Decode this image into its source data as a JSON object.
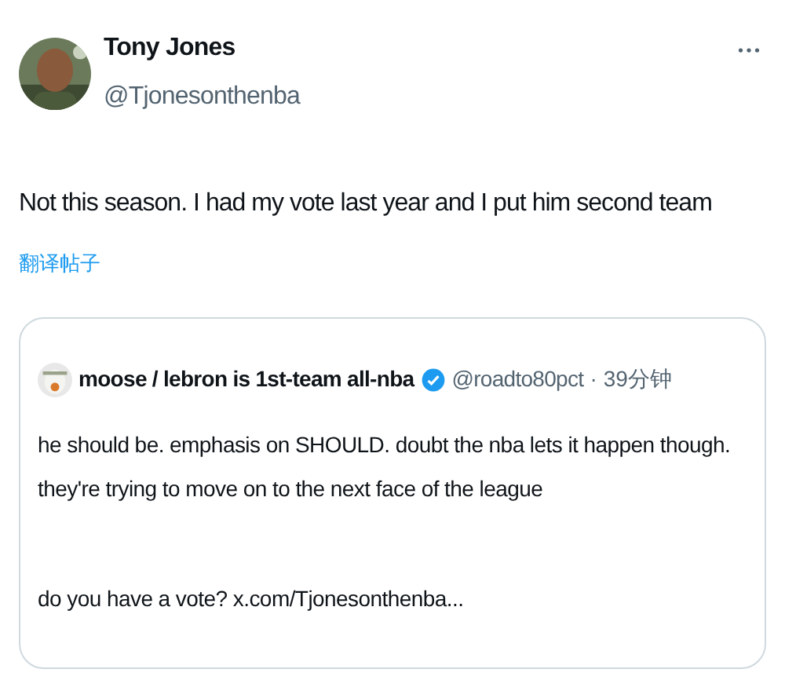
{
  "author": {
    "name": "Tony Jones",
    "handle": "@Tjonesonthenba"
  },
  "text": "Not this season. I had my vote last year and I put him second team",
  "translate_link": "翻译帖子",
  "quote": {
    "name": "moose / lebron is 1st-team all-nba",
    "verified": true,
    "handle": "@roadto80pct",
    "separator": "·",
    "time": "39分钟",
    "paragraphs": [
      "he should be. emphasis on SHOULD. doubt the nba lets it happen though. they're trying to move on to the next face of the league",
      "do you have a vote? x.com/Tjonesonthenba..."
    ]
  }
}
